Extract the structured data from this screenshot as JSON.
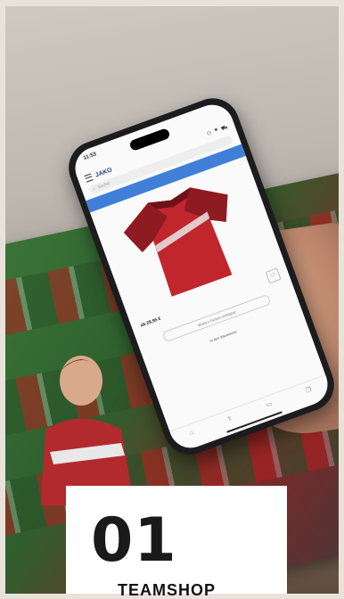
{
  "photo": {
    "phone": {
      "status_time": "11:53",
      "brand": "JAKO",
      "search_placeholder": "Suche",
      "price": "ab 29,95 €",
      "variant_label": "Weitere Farben verfügbar",
      "cart_label": "In den Warenkorb"
    }
  },
  "card": {
    "number": "01",
    "title": "TEAMSHOP"
  },
  "colors": {
    "jersey_red": "#c0262c",
    "jersey_dark": "#6e1219",
    "brand_blue": "#1d3f8a",
    "banner_blue": "#3f7fd8",
    "card_bg": "#ffffff"
  }
}
